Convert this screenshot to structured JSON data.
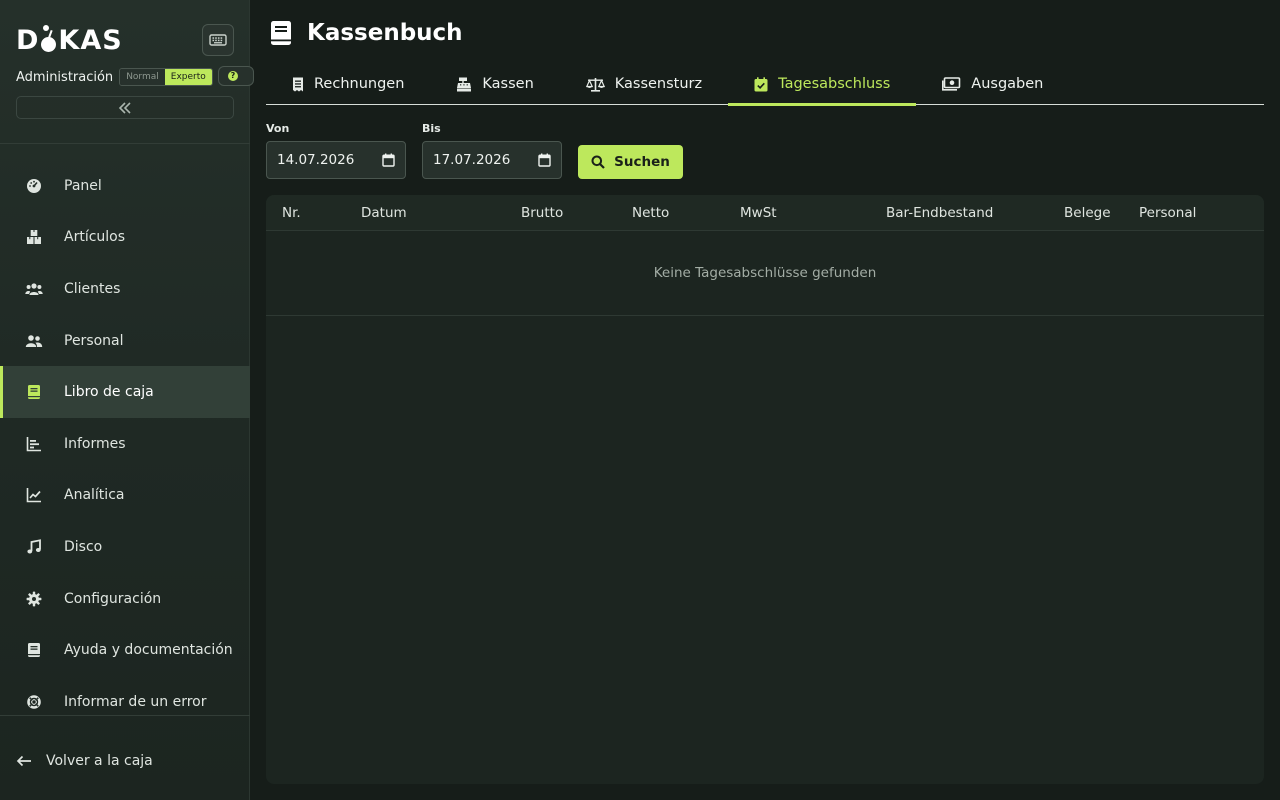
{
  "brand": {
    "letters_before": "D",
    "letters_after": "KAS"
  },
  "sidebar": {
    "admin_label": "Administración",
    "modes": [
      {
        "label": "Normal",
        "active": false
      },
      {
        "label": "Experto",
        "active": true
      }
    ],
    "help_label": "?",
    "items": [
      {
        "label": "Panel",
        "icon": "gauge-icon",
        "active": false
      },
      {
        "label": "Artículos",
        "icon": "boxes-icon",
        "active": false
      },
      {
        "label": "Clientes",
        "icon": "users-icon",
        "active": false
      },
      {
        "label": "Personal",
        "icon": "user-group-icon",
        "active": false
      },
      {
        "label": "Libro de caja",
        "icon": "book-icon",
        "active": true
      },
      {
        "label": "Informes",
        "icon": "bar-chart-icon",
        "active": false
      },
      {
        "label": "Analítica",
        "icon": "line-chart-icon",
        "active": false
      },
      {
        "label": "Disco",
        "icon": "music-note-icon",
        "active": false
      },
      {
        "label": "Configuración",
        "icon": "gear-icon",
        "active": false
      },
      {
        "label": "Ayuda y documentación",
        "icon": "docs-icon",
        "active": false
      },
      {
        "label": "Informar de un error",
        "icon": "lifebuoy-icon",
        "active": false
      }
    ],
    "back_label": "Volver a la caja"
  },
  "header": {
    "title": "Kassenbuch"
  },
  "tabs": [
    {
      "label": "Rechnungen",
      "icon": "receipt-icon",
      "active": false
    },
    {
      "label": "Kassen",
      "icon": "cash-register-icon",
      "active": false
    },
    {
      "label": "Kassensturz",
      "icon": "scale-icon",
      "active": false
    },
    {
      "label": "Tagesabschluss",
      "icon": "calendar-check-icon",
      "active": true
    },
    {
      "label": "Ausgaben",
      "icon": "money-bill-icon",
      "active": false
    }
  ],
  "filters": {
    "from_label": "Von",
    "from_value": "14.07.2026",
    "to_label": "Bis",
    "to_value": "17.07.2026",
    "search_label": "Suchen"
  },
  "table": {
    "columns": [
      "Nr.",
      "Datum",
      "Brutto",
      "Netto",
      "MwSt",
      "Bar-Endbestand",
      "Belege",
      "Personal"
    ],
    "empty_message": "Keine Tagesabschlüsse gefunden"
  },
  "colors": {
    "accent": "#bde85c",
    "background": "#161d19",
    "sidebar": "#25302a",
    "panel": "#1c2520"
  }
}
